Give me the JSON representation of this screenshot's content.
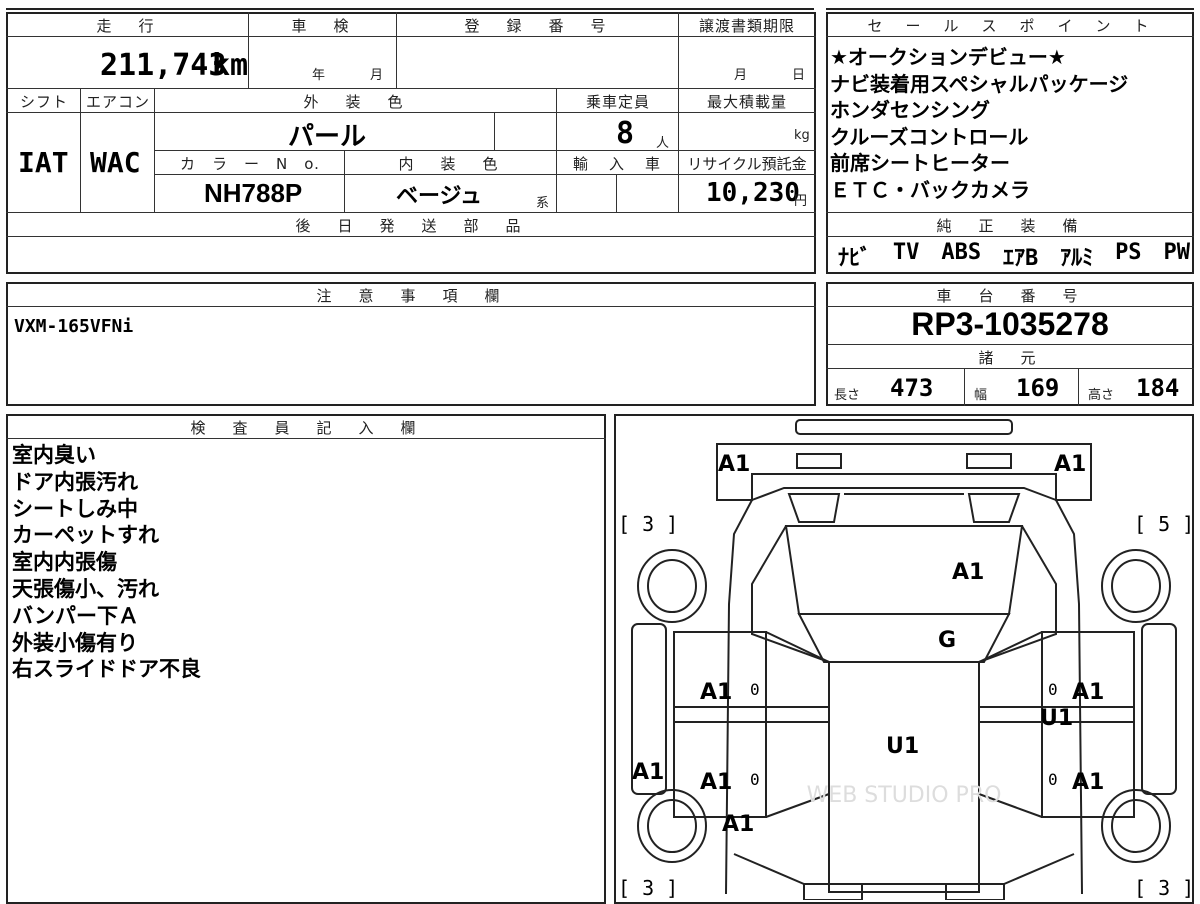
{
  "top_left": {
    "headers": {
      "mileage": "走　行",
      "shaken": "車　検",
      "registration": "登　録　番　号",
      "transfer_deadline": "譲渡書類期限"
    },
    "mileage_value": "211,743",
    "mileage_unit": "km",
    "shaken_year": "年",
    "shaken_month": "月",
    "deadline_month": "月",
    "deadline_day": "日",
    "row2_headers": {
      "shift": "シフト",
      "aircon": "エアコン",
      "exterior": "外　装　色",
      "capacity": "乗車定員",
      "max_load": "最大積載量"
    },
    "shift_value": "IAT",
    "aircon_value": "WAC",
    "exterior_value": "パール",
    "capacity_value": "8",
    "capacity_unit": "人",
    "max_load_unit": "kg",
    "row3_headers": {
      "color_no": "カ　ラ　ー　N　o.",
      "interior": "内　装　色",
      "import": "輸　入　車",
      "recycle": "リサイクル預託金"
    },
    "color_no_value": "NH788P",
    "interior_value": "ベージュ",
    "interior_suffix": "系",
    "recycle_value": "10,230",
    "recycle_unit": "円",
    "later_parts_header": "後　日　発　送　部　品"
  },
  "sales_points": {
    "header": "セ　ー　ル　ス　ポ　イ　ン　ト",
    "items": [
      "★オークションデビュー★",
      "ナビ装着用スペシャルパッケージ",
      "ホンダセンシング",
      "クルーズコントロール",
      "前席シートヒーター",
      "ＥＴＣ・バックカメラ"
    ]
  },
  "genuine_equipment": {
    "header": "純　正　装　備",
    "items": [
      "ﾅﾋﾞ",
      "TV",
      "ABS",
      "ｴｱB",
      "ｱﾙﾐ",
      "PS",
      "PW"
    ]
  },
  "notes": {
    "header": "注　意　事　項　欄",
    "text": "VXM-165VFNi"
  },
  "chassis": {
    "header": "車　台　番　号",
    "value": "RP3-1035278",
    "specs_header": "諸　元",
    "length_label": "長さ",
    "length_value": "473",
    "width_label": "幅",
    "width_value": "169",
    "height_label": "高さ",
    "height_value": "184"
  },
  "inspector": {
    "header": "検　査　員　記　入　欄",
    "lines": [
      "室内臭い",
      "ドア内張汚れ",
      "シートしみ中",
      "カーペットすれ",
      "室内内張傷",
      "天張傷小、汚れ",
      "バンパー下Ａ",
      "外装小傷有り",
      "右スライドドア不良"
    ]
  },
  "diagram": {
    "tire_front_left": "[ 3 ]",
    "tire_front_right": "[ 5 ]",
    "tire_rear_left": "[ 3 ]",
    "tire_rear_right": "[ 3 ]",
    "marks": {
      "front_left_corner": "A1",
      "front_right_corner": "A1",
      "hood": "A1",
      "windshield": "G",
      "left_front_door": "A1",
      "right_front_door": "A1",
      "right_slide": "U1",
      "roof": "U1",
      "left_rear_fender": "A1",
      "left_rear_door": "A1",
      "right_rear_door": "A1",
      "left_rear_lower": "A1"
    },
    "zeros": [
      "0",
      "0",
      "0",
      "0"
    ],
    "watermark": "WEB STUDIO PRO"
  }
}
